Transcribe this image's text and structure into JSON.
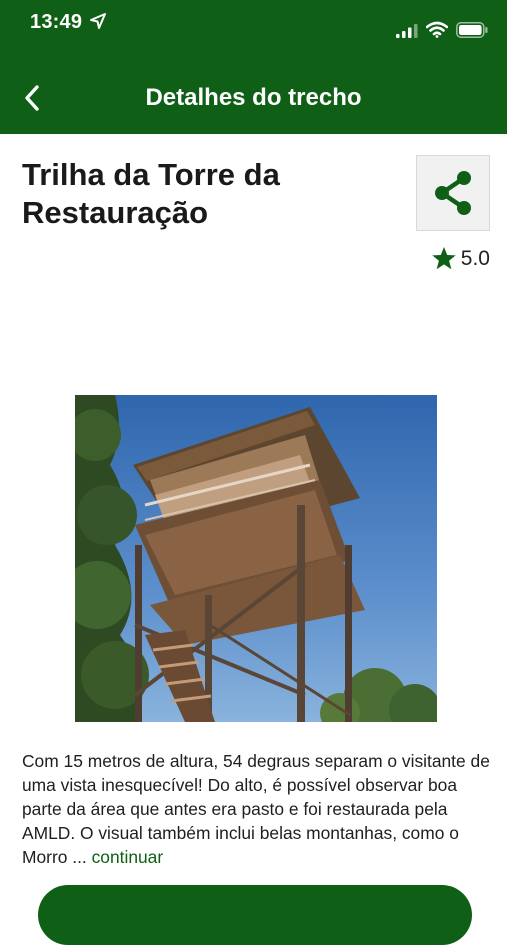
{
  "status_bar": {
    "time": "13:49",
    "icons": [
      "location-arrow-icon",
      "cellular-signal-icon",
      "wifi-icon",
      "battery-icon"
    ]
  },
  "nav": {
    "back_icon": "chevron-left-icon",
    "title": "Detalhes do trecho"
  },
  "trail": {
    "title": "Trilha da Torre da Restauração",
    "share_icon": "share-icon",
    "rating": "5.0",
    "rating_icon": "star-icon",
    "photo_icon": "observation-tower-photo",
    "description": "Com 15 metros de altura, 54 degraus separam o visitante de uma vista inesquecível! Do alto, é possível observar boa parte da área que antes era pasto e foi restaurada pela AMLD. O visual também inclui belas montanhas, como o Morro",
    "ellipsis": "...",
    "more_label": "continuar"
  },
  "colors": {
    "brand_green": "#0f5f16",
    "background": "#ffffff",
    "text": "#1f1f1f"
  }
}
